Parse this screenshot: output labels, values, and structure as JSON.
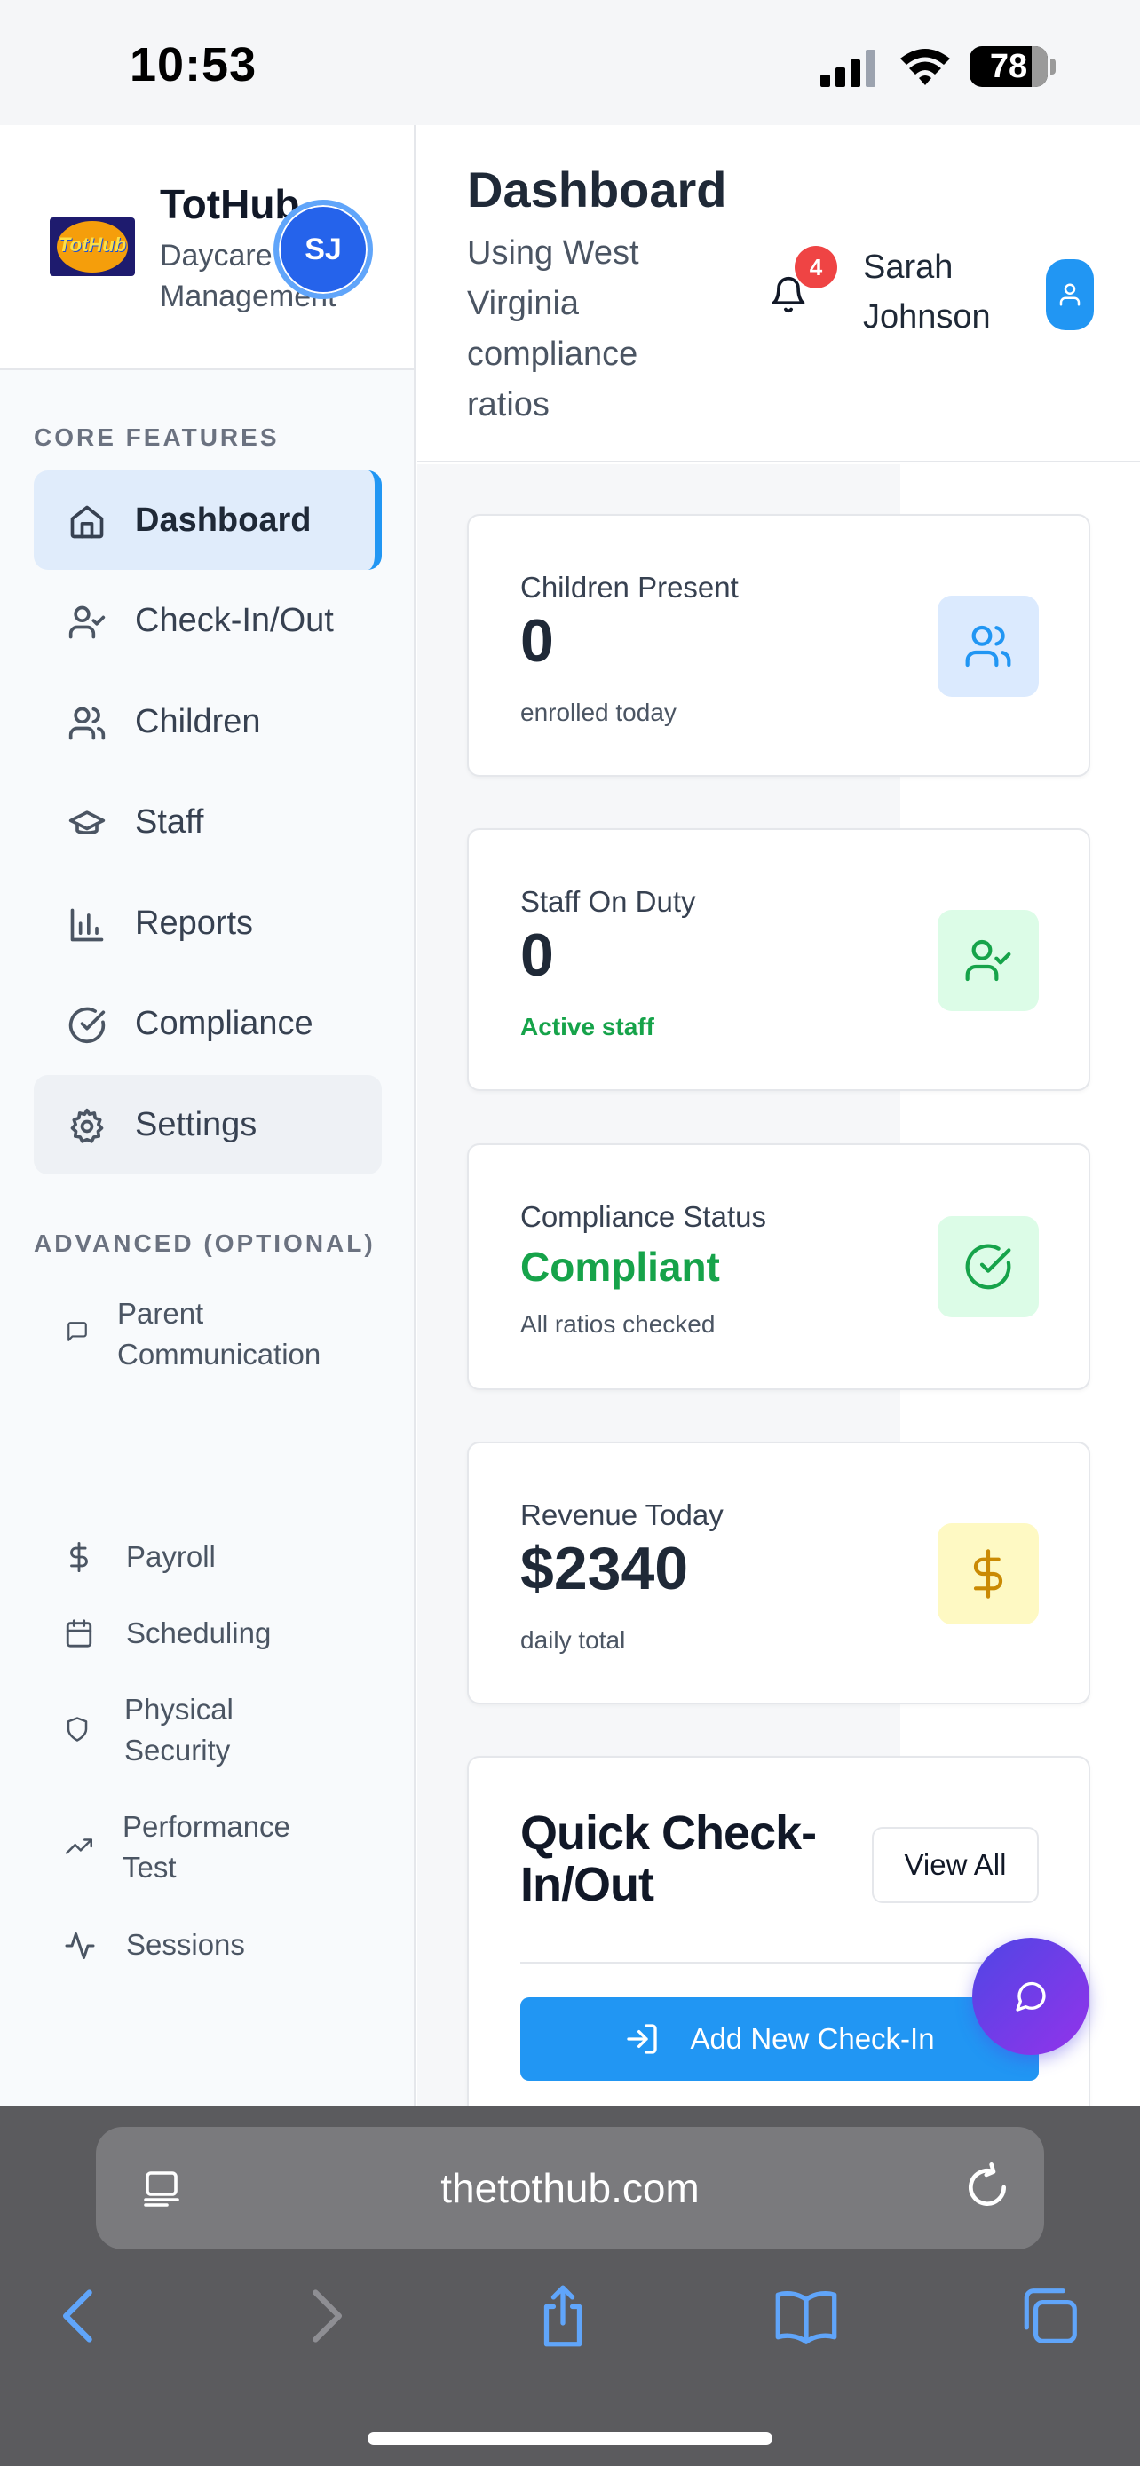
{
  "status_bar": {
    "time": "10:53",
    "battery": "78"
  },
  "sidebar": {
    "brand_name": "TotHub",
    "brand_sub": "Daycare Management",
    "logo_text": "TotHub",
    "avatar_initials": "SJ",
    "core_title": "CORE FEATURES",
    "core_items": [
      {
        "label": "Dashboard",
        "icon": "home-icon"
      },
      {
        "label": "Check-In/Out",
        "icon": "user-check-icon"
      },
      {
        "label": "Children",
        "icon": "users-icon"
      },
      {
        "label": "Staff",
        "icon": "graduation-cap-icon"
      },
      {
        "label": "Reports",
        "icon": "bar-chart-icon"
      },
      {
        "label": "Compliance",
        "icon": "check-circle-icon"
      },
      {
        "label": "Settings",
        "icon": "gear-icon"
      }
    ],
    "advanced_title": "ADVANCED (OPTIONAL)",
    "advanced_items": [
      {
        "label_1": "Parent",
        "label_2": "Communication",
        "icon": "message-icon"
      },
      {
        "label": "Payroll",
        "icon": "dollar-icon"
      },
      {
        "label": "Scheduling",
        "icon": "calendar-icon"
      },
      {
        "label_1": "Physical",
        "label_2": "Security",
        "icon": "shield-icon"
      },
      {
        "label_1": "Performance",
        "label_2": "Test",
        "icon": "trending-up-icon"
      },
      {
        "label": "Sessions",
        "icon": "activity-icon"
      }
    ]
  },
  "header": {
    "title": "Dashboard",
    "subtitle": "Using West Virginia compliance ratios",
    "notification_count": "4",
    "user_name": "Sarah Johnson"
  },
  "cards": [
    {
      "label": "Children Present",
      "value": "0",
      "note": "enrolled today",
      "icon": "users-icon",
      "icon_bg": "#dbeafe",
      "icon_color": "#2196f3"
    },
    {
      "label": "Staff On Duty",
      "value": "0",
      "note": "Active staff",
      "icon": "user-check-icon",
      "icon_bg": "#dcfce7",
      "icon_color": "#16a34a",
      "note_color": "#16a34a"
    },
    {
      "label": "Compliance Status",
      "value": "Compliant",
      "note": "All ratios checked",
      "icon": "check-circle-icon",
      "icon_bg": "#dcfce7",
      "icon_color": "#16a34a",
      "value_color": "#16a34a"
    },
    {
      "label": "Revenue Today",
      "value": "$2340",
      "note": "daily total",
      "icon": "dollar-icon",
      "icon_bg": "#fef9c3",
      "icon_color": "#ca8a04"
    }
  ],
  "quick_checkin": {
    "title": "Quick Check-In/Out",
    "view_all": "View All",
    "add_button": "Add New Check-In"
  },
  "browser": {
    "url": "thetothub.com"
  },
  "colors": {
    "accent": "#2196f3",
    "success": "#16a34a",
    "badge": "#ef4444"
  }
}
